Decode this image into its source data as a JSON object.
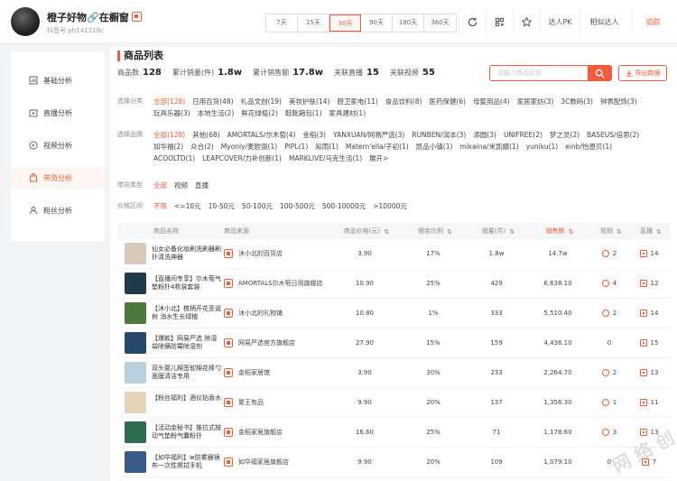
{
  "header": {
    "name": "橙子好物🔗在橱窗",
    "uid": "抖音号:ph141319c",
    "ranges": [
      "7天",
      "15天",
      "30天",
      "90天",
      "180天",
      "360天"
    ],
    "active_range": "30天",
    "buttons": {
      "compare": "达人PK",
      "similar": "相似达人",
      "follow": "追踪"
    }
  },
  "sidebar": {
    "items": [
      {
        "label": "基础分析",
        "icon": "chart-icon"
      },
      {
        "label": "直播分析",
        "icon": "live-icon"
      },
      {
        "label": "视频分析",
        "icon": "video-icon"
      },
      {
        "label": "带货分析",
        "icon": "cart-icon"
      },
      {
        "label": "粉丝分析",
        "icon": "user-icon"
      }
    ],
    "active": "带货分析"
  },
  "main": {
    "title": "商品列表",
    "stats": [
      {
        "label": "商品数",
        "value": "128"
      },
      {
        "label": "累计销量(件)",
        "value": "1.8w"
      },
      {
        "label": "累计销售额",
        "value": "17.8w"
      },
      {
        "label": "关联直播",
        "value": "15"
      },
      {
        "label": "关联视频",
        "value": "55"
      }
    ],
    "search_placeholder": "请输入商品标题",
    "export_label": "导出数据"
  },
  "filters": {
    "category": {
      "label": "选择分类",
      "options": [
        "全部(128)",
        "日用百货(48)",
        "礼品文创(19)",
        "美妆护肤(14)",
        "厨卫家电(11)",
        "食品饮料(8)",
        "医药保健(6)",
        "母婴用品(4)",
        "家居家纺(3)",
        "3C数码(3)",
        "钟表配饰(3)",
        "玩具乐器(3)",
        "本地生活(2)",
        "鲜花绿植(2)",
        "鞋靴箱包(1)",
        "家具建材(1)"
      ]
    },
    "brand": {
      "label": "选择品牌",
      "options": [
        "全部(128)",
        "其他(68)",
        "AMORTALS/尔木萄(4)",
        "金稻(3)",
        "YANXUAN/网易严选(3)",
        "RUNBEN/润本(3)",
        "添圆(3)",
        "UNIFREE(2)",
        "梦之灵(2)",
        "BASEUS/倍思(2)",
        "如华福(2)",
        "众合(2)",
        "Myonly/麦欧丽(1)",
        "PIPL(1)",
        "知雨(1)",
        "Matern'ella/子初(1)",
        "凯品小镇(1)",
        "mikaina/米凯娜(1)",
        "yuniku(1)",
        "einb/怡恩贝(1)",
        "ACOOLTD(1)",
        "LEAPCOVER/力补创新(1)",
        "MARKLIVE/马克生活(1)",
        "展开>"
      ]
    },
    "type": {
      "label": "带货类型",
      "options": [
        "全部",
        "视频",
        "直播"
      ]
    },
    "price": {
      "label": "价格区间",
      "options": [
        "不限",
        "<=10元",
        "10-50元",
        "50-100元",
        "100-500元",
        "500-10000元",
        ">10000元"
      ]
    }
  },
  "table": {
    "headers": [
      "商品名称",
      "商品来源",
      "商品价格(元)",
      "佣金比例",
      "销量(件)",
      "销售额",
      "视频",
      "直播"
    ],
    "rows": [
      {
        "title": "仙女必备化妆刷洗刷器刷扑清洗神器",
        "thumb": "#d9c9bb",
        "shop": "沐小北的百货店",
        "price": "3.90",
        "ratio": "17%",
        "sales": "1.8w",
        "amount": "14.7w",
        "video": "2",
        "live": "14"
      },
      {
        "title": "【直播间专享】尔木萄气垫粉扑4枚装套装",
        "thumb": "#1f3a4d",
        "shop": "AMORTALS尔木萄日用旗舰店",
        "price": "10.90",
        "ratio": "25%",
        "sales": "429",
        "amount": "6,638.10",
        "video": "4",
        "live": "12"
      },
      {
        "title": "【沐小北】梳柄开花圣诞树 消水生长绿植",
        "thumb": "#4d7a3c",
        "shop": "沐小北的礼物铺",
        "price": "10.80",
        "ratio": "1%",
        "sales": "333",
        "amount": "5,510.40",
        "video": "2",
        "live": "14"
      },
      {
        "title": "【爆款】网易严选 除湿袋除螨防霉除湿剂",
        "thumb": "#274a6b",
        "shop": "网易严选官方旗舰店",
        "price": "27.90",
        "ratio": "15%",
        "sales": "159",
        "amount": "4,436.10",
        "video": "0",
        "live": "15"
      },
      {
        "title": "双头婴儿棉签软棉花棒勺面膜清洁专用",
        "thumb": "#b9d0e0",
        "shop": "金稻家居馆",
        "price": "3.90",
        "ratio": "30%",
        "sales": "233",
        "amount": "2,264.70",
        "video": "2",
        "live": "13"
      },
      {
        "title": "【粉丝福利】酒仪钻香水",
        "thumb": "#e5d4b8",
        "shop": "聚王有品",
        "price": "9.90",
        "ratio": "20%",
        "sales": "137",
        "amount": "1,356.30",
        "video": "1",
        "live": "11"
      },
      {
        "title": "【活动金秘书】推拉式按动气垫粉气囊粉扑",
        "thumb": "#2e6e4e",
        "shop": "金稻家居旗舰店",
        "price": "16.60",
        "ratio": "25%",
        "sales": "71",
        "amount": "1,178.60",
        "video": "3",
        "live": "13"
      },
      {
        "title": "【如华福利】w防雾器镜布一次性擦拭手机",
        "thumb": "#3a5a8a",
        "shop": "如华福家居旗舰店",
        "price": "9.90",
        "ratio": "20%",
        "sales": "109",
        "amount": "1,079.10",
        "video": "0",
        "live": "7"
      }
    ]
  },
  "colors": {
    "accent": "#f25c3b"
  }
}
